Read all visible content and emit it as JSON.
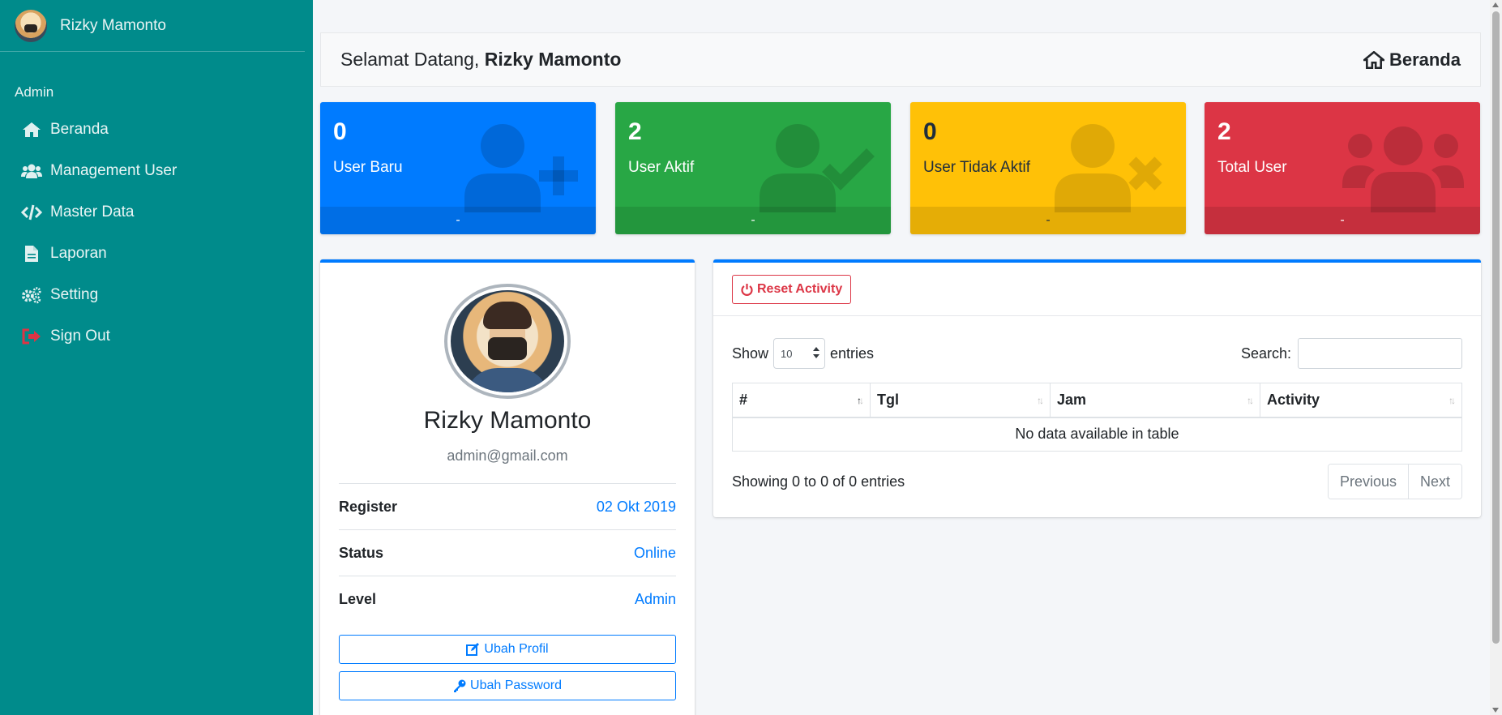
{
  "sidebar": {
    "user_name": "Rizky Mamonto",
    "section_label": "Admin",
    "items": [
      {
        "label": "Beranda",
        "icon": "home-icon"
      },
      {
        "label": "Management User",
        "icon": "users-icon"
      },
      {
        "label": "Master Data",
        "icon": "code-icon"
      },
      {
        "label": "Laporan",
        "icon": "file-icon"
      },
      {
        "label": "Setting",
        "icon": "cogs-icon"
      },
      {
        "label": "Sign Out",
        "icon": "sign-out-icon"
      }
    ],
    "bg_color": "#008b8b",
    "signout_icon_color": "#dc3545"
  },
  "header": {
    "welcome_prefix": "Selamat Datang,",
    "welcome_name": "Rizky Mamonto",
    "breadcrumb": "Beranda"
  },
  "stats": [
    {
      "value": "0",
      "label": "User Baru",
      "footer": "-",
      "color": "#007bff",
      "icon": "user-plus-icon"
    },
    {
      "value": "2",
      "label": "User Aktif",
      "footer": "-",
      "color": "#28a745",
      "icon": "user-check-icon"
    },
    {
      "value": "0",
      "label": "User Tidak Aktif",
      "footer": "-",
      "color": "#ffc107",
      "icon": "user-times-icon"
    },
    {
      "value": "2",
      "label": "Total User",
      "footer": "-",
      "color": "#dc3545",
      "icon": "users-icon"
    }
  ],
  "profile": {
    "name": "Rizky Mamonto",
    "email": "admin@gmail.com",
    "rows": [
      {
        "key": "Register",
        "value": "02 Okt 2019"
      },
      {
        "key": "Status",
        "value": "Online"
      },
      {
        "key": "Level",
        "value": "Admin"
      }
    ],
    "edit_profile_label": "Ubah Profil",
    "edit_password_label": "Ubah Password"
  },
  "activity": {
    "reset_label": "Reset Activity",
    "show_label": "Show",
    "entries_label": "entries",
    "page_length": "10",
    "search_label": "Search:",
    "search_value": "",
    "columns": [
      "#",
      "Tgl",
      "Jam",
      "Activity"
    ],
    "empty_message": "No data available in table",
    "info": "Showing 0 to 0 of 0 entries",
    "prev_label": "Previous",
    "next_label": "Next"
  }
}
